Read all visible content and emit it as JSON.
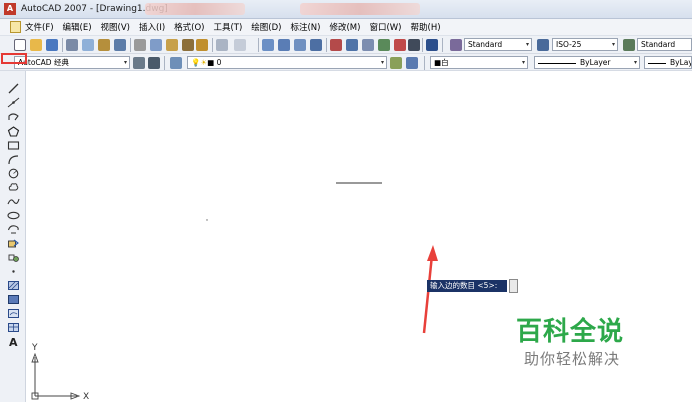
{
  "window": {
    "title": "AutoCAD 2007 - [Drawing1.dwg]",
    "app_icon_text": "A"
  },
  "menu": {
    "items": [
      "文件(F)",
      "编辑(E)",
      "视图(V)",
      "插入(I)",
      "格式(O)",
      "工具(T)",
      "绘图(D)",
      "标注(N)",
      "修改(M)",
      "窗口(W)",
      "帮助(H)"
    ]
  },
  "toolbar": {
    "text_style": "Standard",
    "dim_style": "ISO-25",
    "table_style": "Standard",
    "workspace": "AutoCAD 经典",
    "layer": "0",
    "color_combo": "■白",
    "linetype": "ByLayer",
    "lineweight": "ByLay"
  },
  "command": {
    "prompt": "输入边的数目 <5>:",
    "input_value": ""
  },
  "watermark": {
    "title": "百科全说",
    "subtitle": "助你轻松解决"
  },
  "ucs": {
    "x_label": "X",
    "y_label": "Y"
  },
  "colors": {
    "highlight_red": "#e53935",
    "watermark_green": "#2da84a",
    "prompt_bg": "#1b3366",
    "arrow_red": "#e8403a"
  }
}
